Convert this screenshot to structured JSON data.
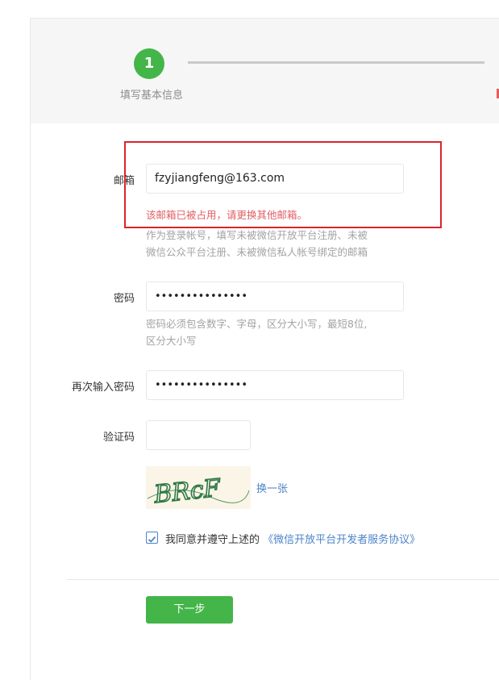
{
  "steps": {
    "current_number": "1",
    "current_label": "填写基本信息"
  },
  "form": {
    "email": {
      "label": "邮箱",
      "value": "fzyjiangfeng@163.com",
      "error": "该邮箱已被占用，请更换其他邮箱。",
      "hint_lines": [
        "作为登录帐号，填写未被微信开放平台注册、未被",
        "微信公众平台注册、未被微信私人帐号绑定的邮箱"
      ]
    },
    "password": {
      "label": "密码",
      "value": "•••••••••••••••",
      "hint_lines": [
        "密码必须包含数字、字母，区分大小写，最短8位,",
        "区分大小写"
      ]
    },
    "confirm_password": {
      "label": "再次输入密码",
      "value": "•••••••••••••••"
    },
    "captcha": {
      "label": "验证码",
      "value": "",
      "image_text": "BRcF",
      "refresh_label": "换一张"
    },
    "agreement": {
      "checked": true,
      "text": "我同意并遵守上述的",
      "link": "《微信开放平台开发者服务协议》"
    },
    "next_button": "下一步"
  },
  "colors": {
    "primary_green": "#44b549",
    "link_blue": "#4d84c8",
    "error_red": "#e15f63",
    "highlight_box": "#d9252b"
  }
}
